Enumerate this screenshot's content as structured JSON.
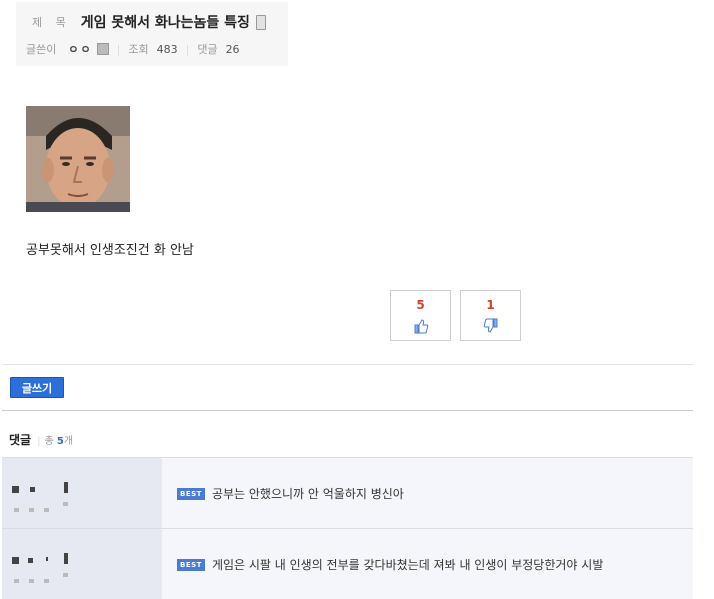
{
  "post": {
    "title_label": "제 목",
    "title": "게임 못해서 화나는놈들 특징",
    "author_label": "글쓴이",
    "author": "ㅇㅇ",
    "views_label": "조회",
    "views": "483",
    "comments_label": "댓글",
    "comments": "26",
    "body": "공부못해서 인생조진건 화 안남"
  },
  "votes": {
    "up": "5",
    "down": "1"
  },
  "write_button": "글쓰기",
  "comments_section": {
    "title": "댓글",
    "total_prefix": "총 ",
    "total_count": "5",
    "total_suffix": "개",
    "items": [
      {
        "badge": "BEST",
        "text": "공부는 안했으니까 안 억울하지 병신아"
      },
      {
        "badge": "BEST",
        "text": "게임은 시팔 내 인생의 전부를 갖다바쳤는데 져봐 내 인생이 부정당한거야 시발"
      }
    ]
  },
  "colors": {
    "accent": "#2d6fd8",
    "vote_count": "#d44030",
    "best_badge": "#4a7bd0"
  }
}
